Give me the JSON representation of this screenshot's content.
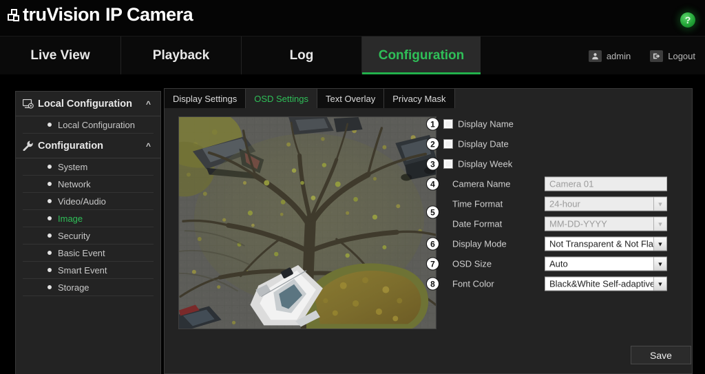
{
  "header": {
    "brand_tru": "truVision",
    "brand_product": "IP Camera",
    "logo_icon": "stacked-squares-logo-icon",
    "help_icon": "help-question-icon",
    "help_label": "?"
  },
  "nav": {
    "items": [
      {
        "label": "Live View",
        "active": false
      },
      {
        "label": "Playback",
        "active": false
      },
      {
        "label": "Log",
        "active": false
      },
      {
        "label": "Configuration",
        "active": true
      }
    ],
    "user": {
      "name": "admin",
      "user_icon": "user-avatar-icon",
      "logout_label": "Logout",
      "logout_icon": "logout-arrow-icon"
    }
  },
  "sidebar": {
    "groups": [
      {
        "label": "Local Configuration",
        "icon": "monitor-gear-icon",
        "chevron": "chevron-up-icon",
        "items": [
          {
            "label": "Local Configuration",
            "active": false
          }
        ]
      },
      {
        "label": "Configuration",
        "icon": "wrench-icon",
        "chevron": "chevron-up-icon",
        "items": [
          {
            "label": "System",
            "active": false
          },
          {
            "label": "Network",
            "active": false
          },
          {
            "label": "Video/Audio",
            "active": false
          },
          {
            "label": "Image",
            "active": true
          },
          {
            "label": "Security",
            "active": false
          },
          {
            "label": "Basic Event",
            "active": false
          },
          {
            "label": "Smart Event",
            "active": false
          },
          {
            "label": "Storage",
            "active": false
          }
        ]
      }
    ]
  },
  "content": {
    "tabs": [
      {
        "label": "Display Settings",
        "active": false
      },
      {
        "label": "OSD Settings",
        "active": true
      },
      {
        "label": "Text Overlay",
        "active": false
      },
      {
        "label": "Privacy Mask",
        "active": false
      }
    ],
    "preview": {
      "name": "camera-live-preview",
      "description": "Aerial view of a parking lot with a large bare tree, parked cars and autumn leaves"
    },
    "form": {
      "rows": [
        {
          "callout": "1",
          "type": "checkbox",
          "label": "Display Name",
          "checked": false
        },
        {
          "callout": "2",
          "type": "checkbox",
          "label": "Display Date",
          "checked": false
        },
        {
          "callout": "3",
          "type": "checkbox",
          "label": "Display Week",
          "checked": false
        },
        {
          "callout": "4",
          "type": "text",
          "label": "Camera Name",
          "value": "Camera 01",
          "disabled": true
        },
        {
          "callout": "",
          "type": "select",
          "label": "Time Format",
          "value": "24-hour",
          "disabled": true
        },
        {
          "callout": "5",
          "type": "select",
          "label": "Date Format",
          "value": "MM-DD-YYYY",
          "disabled": true
        },
        {
          "callout": "6",
          "type": "select",
          "label": "Display Mode",
          "value": "Not Transparent & Not Flas",
          "disabled": false
        },
        {
          "callout": "7",
          "type": "select",
          "label": "OSD Size",
          "value": "Auto",
          "disabled": false
        },
        {
          "callout": "8",
          "type": "select",
          "label": "Font Color",
          "value": "Black&White Self-adaptive",
          "disabled": false
        }
      ],
      "arrow_icon": "chevron-down-icon"
    },
    "save_label": "Save"
  },
  "colors": {
    "accent_green": "#2fbf58",
    "page_background": "#000000",
    "panel_background": "#232323",
    "panel_border": "#3a3a3a"
  }
}
